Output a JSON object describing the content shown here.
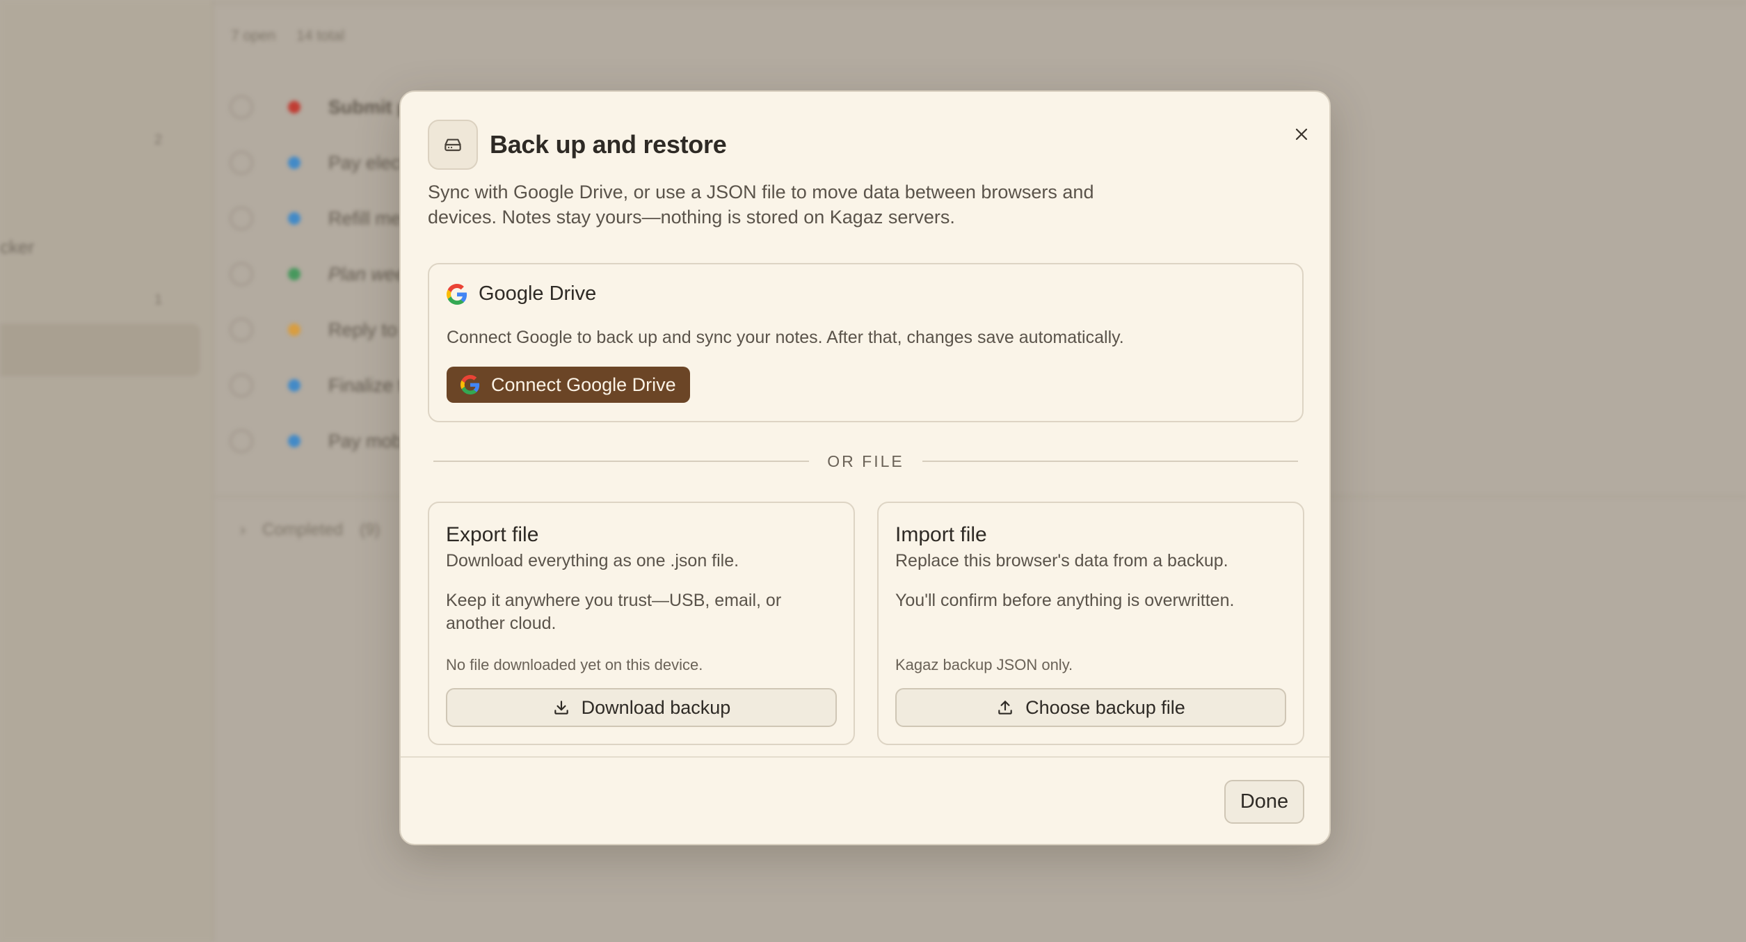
{
  "background": {
    "meta": {
      "open": "7 open",
      "total": "14 total"
    },
    "sidebar": {
      "counts": [
        "2",
        "1"
      ],
      "fragments": [
        "",
        "cker"
      ]
    },
    "tasks": [
      {
        "title": "Submit p",
        "color": "#c6352b",
        "bold": true,
        "italic": false
      },
      {
        "title": "Pay elect",
        "color": "#3a8bd0",
        "bold": false,
        "italic": false
      },
      {
        "title": "Refill me",
        "color": "#3a8bd0",
        "bold": false,
        "italic": false
      },
      {
        "title": "Plan wee",
        "color": "#3f9a5a",
        "bold": false,
        "italic": true
      },
      {
        "title": "Reply to",
        "color": "#e0a03a",
        "bold": false,
        "italic": false
      },
      {
        "title": "Finalize t",
        "color": "#3a8bd0",
        "bold": false,
        "italic": false
      },
      {
        "title": "Pay mob",
        "color": "#3a8bd0",
        "bold": false,
        "italic": false
      }
    ],
    "completed": {
      "label": "Completed",
      "count": "(9)"
    }
  },
  "modal": {
    "title": "Back up and restore",
    "description": "Sync with Google Drive, or use a JSON file to move data between browsers and devices. Notes stay yours—nothing is stored on Kagaz servers.",
    "google_drive": {
      "title": "Google Drive",
      "text": "Connect Google to back up and sync your notes. After that, changes save automatically.",
      "button": "Connect Google Drive"
    },
    "divider_label": "OR FILE",
    "export": {
      "title": "Export file",
      "subtitle": "Download everything as one .json file.",
      "body": "Keep it anywhere you trust—USB, email, or another cloud.",
      "note": "No file downloaded yet on this device.",
      "button": "Download backup"
    },
    "import": {
      "title": "Import file",
      "subtitle": "Replace this browser's data from a backup.",
      "body": "You'll confirm before anything is overwritten.",
      "note": "Kagaz backup JSON only.",
      "button": "Choose backup file"
    },
    "done_button": "Done"
  },
  "colors": {
    "accent": "#6b4526",
    "modal_bg": "#faf4e8",
    "backdrop": "#b7afa4"
  }
}
